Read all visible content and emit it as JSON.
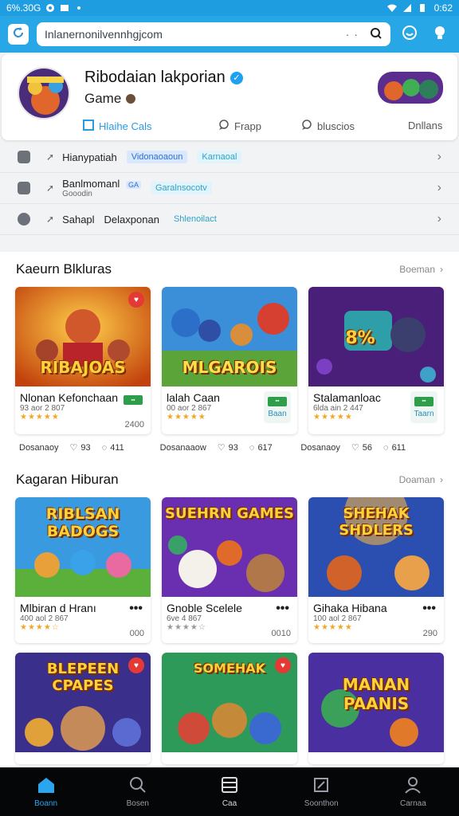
{
  "status_bar": {
    "time_left": "6%.30G",
    "time_right": "0:62"
  },
  "browser": {
    "url": "Inlanernonilvennhgjcom",
    "menu_dots": "· ·"
  },
  "profile": {
    "title": "Ribodaian lakporian",
    "subtitle": "Game",
    "tabs": [
      "Hlaihe Cals",
      "Frapp",
      "bluscios",
      "Dnllans"
    ]
  },
  "info_rows": [
    {
      "label": "Hianypatiah",
      "tags": [
        "Vidonaoaoun",
        "Karnaoal"
      ]
    },
    {
      "label": "Banlmomanl",
      "sub": "Gooodin",
      "badge": "GA",
      "tags": [
        "Garalnsocotv"
      ]
    },
    {
      "label": "Sahapl",
      "label2": "Delaxponan",
      "tags": [
        "Shlenoilact"
      ]
    }
  ],
  "section1": {
    "title": "Kaeurn Blkluras",
    "more": "Boeman",
    "cards": [
      {
        "thumb_title": "RIBAJOAS",
        "name": "Nlonan Kefonchaan",
        "sub": "93 aor 2 807",
        "rating": 5,
        "count": "2400",
        "btn": ""
      },
      {
        "thumb_title": "MLGAROIS",
        "name": "lalah Caan",
        "sub": "00 aor 2 867",
        "rating": 5,
        "count": "",
        "btn": "Baan"
      },
      {
        "thumb_title": "8%",
        "name": "Stalamanloac",
        "sub": "6lda ain 2 447",
        "rating": 5,
        "count": "",
        "btn": "Taarn"
      }
    ],
    "meta": [
      {
        "a": "Dosanaoy",
        "b": "93",
        "c": "411"
      },
      {
        "a": "Dosanaaow",
        "b": "93",
        "c": "617"
      },
      {
        "a": "Dosanaoy",
        "b": "56",
        "c": "611"
      }
    ]
  },
  "section2": {
    "title": "Kagaran Hiburan",
    "more": "Doaman",
    "cards": [
      {
        "thumb_title": "RIBLSAN BADOGS",
        "name": "Mlbiran d Hranı",
        "sub": "400 aol 2 867",
        "rating": 4,
        "count": "000"
      },
      {
        "thumb_title": "SUEHRN GAMES",
        "name": "Gnoble Scelele",
        "sub": "6ve 4 867",
        "rating": 4,
        "count": "0010"
      },
      {
        "thumb_title": "SHEHAK SHDLERS",
        "name": "Gihaka Hibana",
        "sub": "100 aol 2 867",
        "rating": 5,
        "count": "290"
      }
    ],
    "row2_titles": [
      "BLEPEEN CPAPES",
      "SOMEHAK",
      "MANAN PAANIS"
    ]
  },
  "bottom_nav": [
    "Boann",
    "Bosen",
    "Caa",
    "Soonthon",
    "Carnaa"
  ],
  "colors": {
    "accent": "#27a7e6",
    "nav_active": "#2aa5ee",
    "star": "#f4a521"
  }
}
